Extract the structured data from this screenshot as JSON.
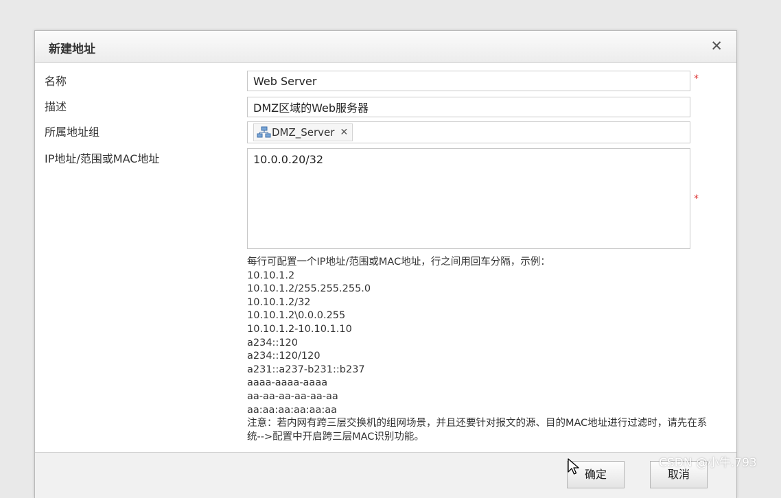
{
  "dialog": {
    "title": "新建地址",
    "close_glyph": "✕"
  },
  "form": {
    "name_label": "名称",
    "name_value": "Web Server",
    "desc_label": "描述",
    "desc_value": "DMZ区域的Web服务器",
    "group_label": "所属地址组",
    "group_tag": "DMZ_Server",
    "tag_remove_glyph": "✕",
    "ip_label": "IP地址/范围或MAC地址",
    "ip_value": "10.0.0.20/32",
    "required_mark": "*"
  },
  "help": {
    "intro": "每行可配置一个IP地址/范围或MAC地址，行之间用回车分隔，示例：",
    "examples": [
      "10.10.1.2",
      "10.10.1.2/255.255.255.0",
      "10.10.1.2/32",
      "10.10.1.2\\0.0.0.255",
      "10.10.1.2-10.10.1.10",
      "a234::120",
      "a234::120/120",
      "a231::a237-b231::b237",
      "aaaa-aaaa-aaaa",
      "aa-aa-aa-aa-aa-aa",
      "aa:aa:aa:aa:aa:aa"
    ],
    "note": "注意：若内网有跨三层交换机的组网场景，并且还要针对报文的源、目的MAC地址进行过滤时，请先在系统-->配置中开启跨三层MAC识别功能。"
  },
  "footer": {
    "ok_label": "确定",
    "cancel_label": "取消"
  },
  "watermark": "CSDN @小牛.793",
  "icons": {
    "group_icon": "network-group-icon",
    "cursor": "mouse-pointer-icon"
  }
}
